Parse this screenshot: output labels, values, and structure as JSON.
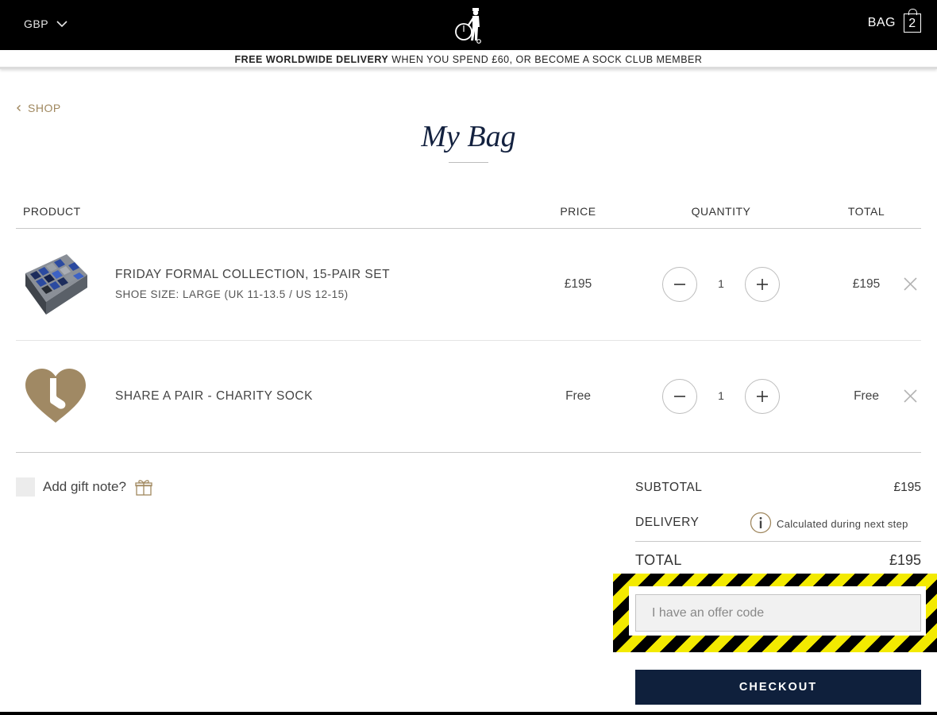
{
  "header": {
    "currency": "GBP",
    "bag_label": "BAG",
    "bag_count": "2",
    "logo_icon": "gentleman-penny-farthing-logo"
  },
  "promo": {
    "bold": "FREE WORLDWIDE DELIVERY",
    "rest": " WHEN YOU SPEND £60, OR BECOME A SOCK CLUB MEMBER"
  },
  "nav": {
    "back_label": "SHOP"
  },
  "page": {
    "title": "My Bag"
  },
  "table": {
    "headers": {
      "product": "PRODUCT",
      "price": "PRICE",
      "quantity": "QUANTITY",
      "total": "TOTAL"
    },
    "items": [
      {
        "name": "FRIDAY FORMAL COLLECTION, 15-PAIR SET",
        "subtitle": "SHOE SIZE: LARGE (UK 11-13.5 / US 12-15)",
        "price": "£195",
        "quantity": "1",
        "total": "£195",
        "thumb_icon": "sock-box-set-image"
      },
      {
        "name": "SHARE A PAIR - CHARITY SOCK",
        "subtitle": "",
        "price": "Free",
        "quantity": "1",
        "total": "Free",
        "thumb_icon": "heart-sock-icon"
      }
    ]
  },
  "gift": {
    "label": "Add gift note?"
  },
  "summary": {
    "subtotal_label": "SUBTOTAL",
    "subtotal_value": "£195",
    "delivery_label": "DELIVERY",
    "delivery_value": "Calculated during next step",
    "total_label": "TOTAL",
    "total_value": "£195"
  },
  "offer": {
    "placeholder": "I have an offer code"
  },
  "checkout": {
    "label": "CHECKOUT"
  },
  "colors": {
    "navy": "#0f203c",
    "gold": "#a0885f",
    "highlight": "#f3ea00"
  }
}
